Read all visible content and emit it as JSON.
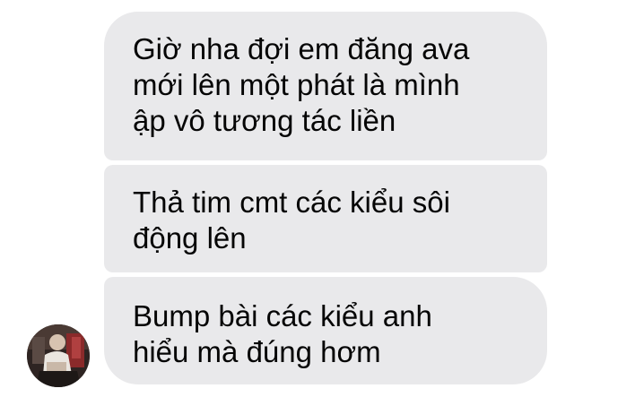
{
  "thread": {
    "messages": [
      {
        "lines": [
          "Giờ nha đợi em đăng ava",
          "mới lên một phát là mình",
          "ập vô tương tác liền"
        ]
      },
      {
        "lines": [
          "Thả tim cmt các kiểu sôi",
          "động lên"
        ]
      },
      {
        "lines": [
          "Bump bài các kiểu anh",
          "hiểu mà đúng hơm"
        ]
      }
    ],
    "sender": {
      "avatar_icon": "profile-photo-icon"
    },
    "colors": {
      "bubble": "#e9e9eb",
      "text": "#050505",
      "background": "#ffffff"
    }
  }
}
